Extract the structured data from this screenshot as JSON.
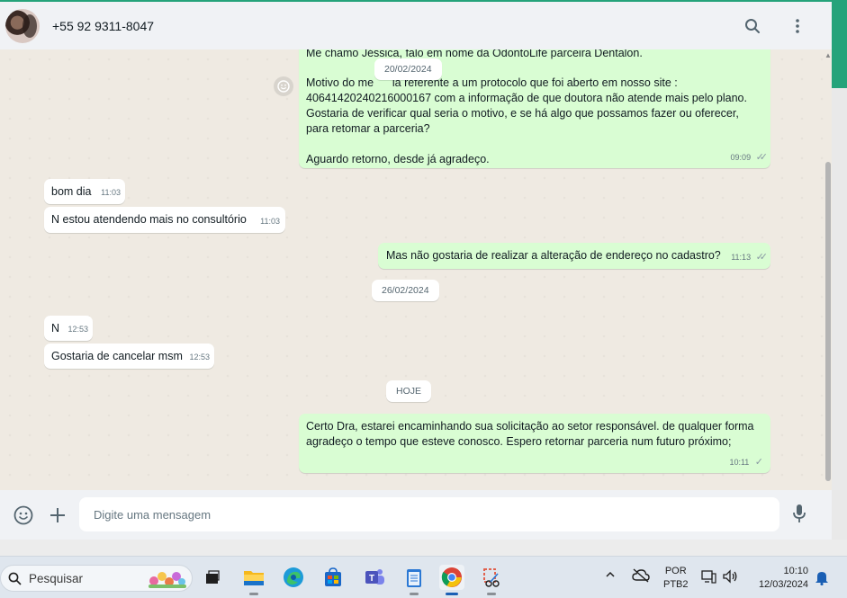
{
  "header": {
    "contact_name": "+55 92 9311-8047",
    "search_icon": "search-icon",
    "menu_icon": "kebab-menu-icon"
  },
  "chat": {
    "top_message": {
      "partial_first_line": "Me chamo Jéssica, falo em nome da OdontoLife parceira Dentalon.",
      "line2": "Motivo do me      ia referente a um protocolo que foi aberto em nosso site :",
      "line3": "40641420240216000167 com a informação de que doutora não atende mais pelo plano.",
      "line4": "Gostaria de verificar qual seria o motivo, e se há algo que possamos fazer ou oferecer,",
      "line5": "para retomar a parceria?",
      "line6": "Aguardo retorno, desde já agradeço.",
      "time": "09:09"
    },
    "date_1": "20/02/2024",
    "msg_bom_dia": {
      "text": "bom dia",
      "time": "11:03"
    },
    "msg_n_estou": {
      "text": "N estou atendendo mais no consultório",
      "time": "11:03"
    },
    "msg_mas_nao": {
      "text": "Mas não gostaria de realizar a alteração de endereço no cadastro?",
      "time": "11:13"
    },
    "date_2": "26/02/2024",
    "msg_n": {
      "text": "N",
      "time": "12:53"
    },
    "msg_cancelar": {
      "text": "Gostaria de cancelar msm",
      "time": "12:53"
    },
    "date_3": "HOJE",
    "msg_certo": {
      "line1": "Certo Dra, estarei encaminhando sua solicitação ao setor responsável. de qualquer forma",
      "line2": "agradeço o tempo que esteve conosco. Espero retornar parceria num futuro próximo;",
      "time": "10:11"
    }
  },
  "composer": {
    "placeholder": "Digite uma mensagem"
  },
  "taskbar": {
    "search_label": "Pesquisar",
    "lang_line1": "POR",
    "lang_line2": "PTB2",
    "time": "10:10",
    "date": "12/03/2024"
  },
  "colors": {
    "outgoing_bubble": "#d9fdd3",
    "incoming_bubble": "#ffffff",
    "chat_background": "#efeae2",
    "header_background": "#f0f2f5",
    "accent_green": "#25a37a"
  }
}
